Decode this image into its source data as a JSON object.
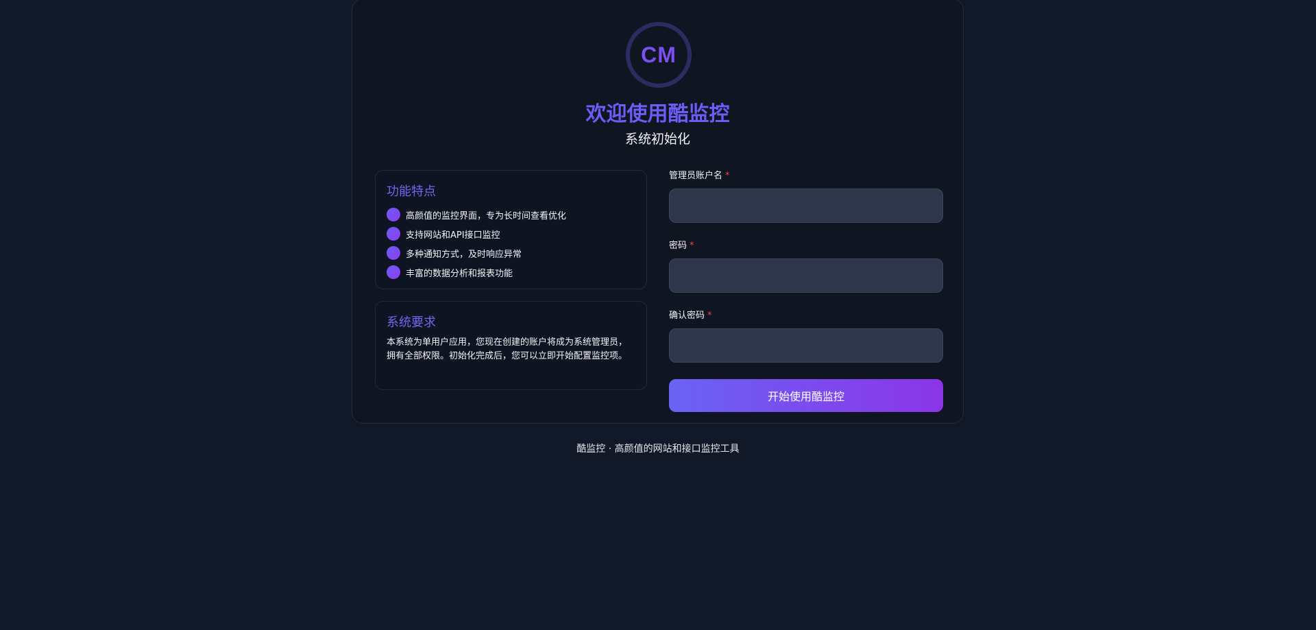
{
  "logo": {
    "text": "CM"
  },
  "header": {
    "title": "欢迎使用酷监控",
    "subtitle": "系统初始化"
  },
  "features": {
    "title": "功能特点",
    "items": [
      "高颜值的监控界面，专为长时间查看优化",
      "支持网站和API接口监控",
      "多种通知方式，及时响应异常",
      "丰富的数据分析和报表功能"
    ]
  },
  "requirements": {
    "title": "系统要求",
    "text": "本系统为单用户应用，您现在创建的账户将成为系统管理员，拥有全部权限。初始化完成后，您可以立即开始配置监控项。"
  },
  "form": {
    "username_label": "管理员账户名",
    "password_label": "密码",
    "confirm_label": "确认密码",
    "required_mark": "*",
    "username_value": "",
    "password_value": "",
    "confirm_value": "",
    "submit_label": "开始使用酷监控"
  },
  "footer": {
    "text": "酷监控 · 高颜值的网站和接口监控工具"
  },
  "colors": {
    "background": "#111827",
    "accent": "#6d5cf5",
    "button_gradient_start": "#6a63f3",
    "button_gradient_end": "#8b35e8",
    "required": "#ef4444"
  }
}
